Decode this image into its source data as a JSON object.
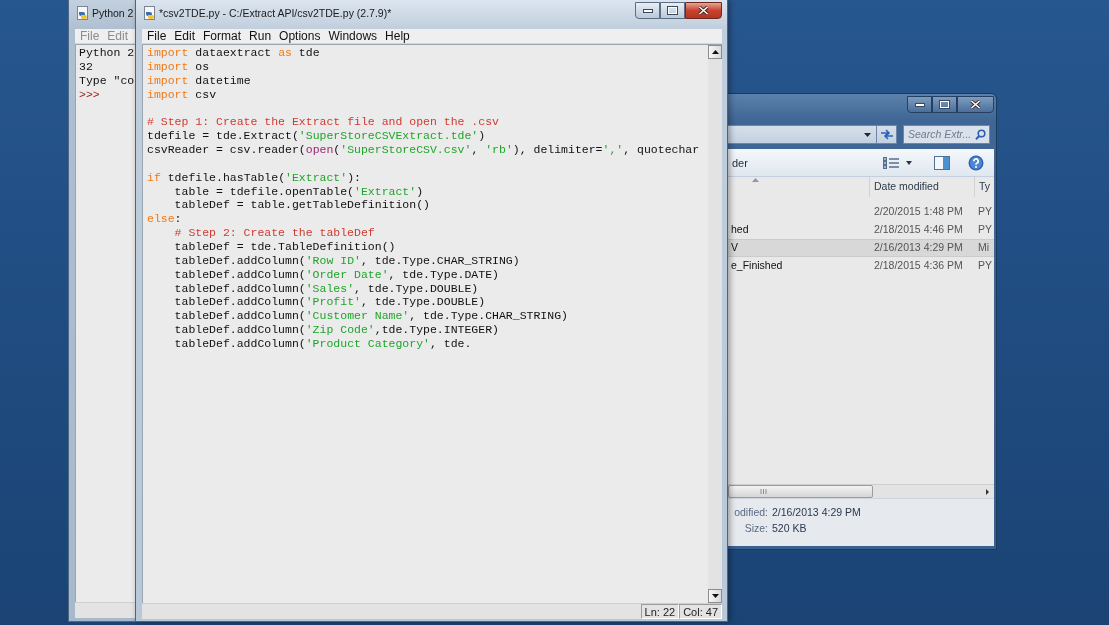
{
  "shell_window": {
    "title": "Python 2",
    "menu": [
      "File",
      "Edit"
    ],
    "lines": [
      {
        "kind": "output",
        "text": "Python 2"
      },
      {
        "kind": "output",
        "text": "32"
      },
      {
        "kind": "output",
        "text": "Type \"co"
      },
      {
        "kind": "prompt",
        "text": ">>>"
      }
    ]
  },
  "editor_window": {
    "title": "*csv2TDE.py - C:/Extract API/csv2TDE.py (2.7.9)*",
    "menu": [
      "File",
      "Edit",
      "Format",
      "Run",
      "Options",
      "Windows",
      "Help"
    ],
    "code_lines": [
      {
        "kind": "code",
        "tokens": [
          {
            "kind": "keyword",
            "text": "import"
          },
          {
            "kind": "plain",
            "text": " dataextract "
          },
          {
            "kind": "keyword",
            "text": "as"
          },
          {
            "kind": "plain",
            "text": " tde"
          }
        ]
      },
      {
        "kind": "code",
        "tokens": [
          {
            "kind": "keyword",
            "text": "import"
          },
          {
            "kind": "plain",
            "text": " os"
          }
        ]
      },
      {
        "kind": "code",
        "tokens": [
          {
            "kind": "keyword",
            "text": "import"
          },
          {
            "kind": "plain",
            "text": " datetime"
          }
        ]
      },
      {
        "kind": "code",
        "tokens": [
          {
            "kind": "keyword",
            "text": "import"
          },
          {
            "kind": "plain",
            "text": " csv"
          }
        ]
      },
      {
        "kind": "blank"
      },
      {
        "kind": "code",
        "tokens": [
          {
            "kind": "comment",
            "text": "# Step 1: Create the Extract file and open the .csv"
          }
        ]
      },
      {
        "kind": "code",
        "tokens": [
          {
            "kind": "plain",
            "text": "tdefile = tde.Extract("
          },
          {
            "kind": "string",
            "text": "'SuperStoreCSVExtract.tde'"
          },
          {
            "kind": "plain",
            "text": ")"
          }
        ]
      },
      {
        "kind": "code",
        "tokens": [
          {
            "kind": "plain",
            "text": "csvReader = csv.reader("
          },
          {
            "kind": "builtin",
            "text": "open"
          },
          {
            "kind": "plain",
            "text": "("
          },
          {
            "kind": "string",
            "text": "'SuperStoreCSV.csv'"
          },
          {
            "kind": "plain",
            "text": ", "
          },
          {
            "kind": "string",
            "text": "'rb'"
          },
          {
            "kind": "plain",
            "text": "), delimiter="
          },
          {
            "kind": "string",
            "text": "','"
          },
          {
            "kind": "plain",
            "text": ", quotechar"
          }
        ]
      },
      {
        "kind": "blank"
      },
      {
        "kind": "code",
        "tokens": [
          {
            "kind": "keyword",
            "text": "if"
          },
          {
            "kind": "plain",
            "text": " tdefile.hasTable("
          },
          {
            "kind": "string",
            "text": "'Extract'"
          },
          {
            "kind": "plain",
            "text": "):"
          }
        ],
        "children": [
          {
            "kind": "code",
            "tokens": [
              {
                "kind": "plain",
                "text": "table = tdefile.openTable("
              },
              {
                "kind": "string",
                "text": "'Extract'"
              },
              {
                "kind": "plain",
                "text": ")"
              }
            ]
          },
          {
            "kind": "code",
            "tokens": [
              {
                "kind": "plain",
                "text": "tableDef = table.getTableDefinition()"
              }
            ]
          }
        ]
      },
      {
        "kind": "code",
        "tokens": [
          {
            "kind": "keyword",
            "text": "else"
          },
          {
            "kind": "plain",
            "text": ":"
          }
        ],
        "children": [
          {
            "kind": "code",
            "tokens": [
              {
                "kind": "comment",
                "text": "# Step 2: Create the tableDef"
              }
            ]
          },
          {
            "kind": "code",
            "tokens": [
              {
                "kind": "plain",
                "text": "tableDef = tde.TableDefinition()"
              }
            ]
          },
          {
            "kind": "code",
            "tokens": [
              {
                "kind": "plain",
                "text": "tableDef.addColumn("
              },
              {
                "kind": "string",
                "text": "'Row ID'"
              },
              {
                "kind": "plain",
                "text": ", tde.Type.CHAR_STRING)"
              }
            ]
          },
          {
            "kind": "code",
            "tokens": [
              {
                "kind": "plain",
                "text": "tableDef.addColumn("
              },
              {
                "kind": "string",
                "text": "'Order Date'"
              },
              {
                "kind": "plain",
                "text": ", tde.Type.DATE)"
              }
            ]
          },
          {
            "kind": "code",
            "tokens": [
              {
                "kind": "plain",
                "text": "tableDef.addColumn("
              },
              {
                "kind": "string",
                "text": "'Sales'"
              },
              {
                "kind": "plain",
                "text": ", tde.Type.DOUBLE)"
              }
            ]
          },
          {
            "kind": "code",
            "tokens": [
              {
                "kind": "plain",
                "text": "tableDef.addColumn("
              },
              {
                "kind": "string",
                "text": "'Profit'"
              },
              {
                "kind": "plain",
                "text": ", tde.Type.DOUBLE)"
              }
            ]
          },
          {
            "kind": "code",
            "tokens": [
              {
                "kind": "plain",
                "text": "tableDef.addColumn("
              },
              {
                "kind": "string",
                "text": "'Customer Name'"
              },
              {
                "kind": "plain",
                "text": ", tde.Type.CHAR_STRING)"
              }
            ]
          },
          {
            "kind": "code",
            "tokens": [
              {
                "kind": "plain",
                "text": "tableDef.addColumn("
              },
              {
                "kind": "string",
                "text": "'Zip Code'"
              },
              {
                "kind": "plain",
                "text": ",tde.Type.INTEGER)"
              }
            ]
          },
          {
            "kind": "code",
            "tokens": [
              {
                "kind": "plain",
                "text": "tableDef.addColumn("
              },
              {
                "kind": "string",
                "text": "'Product Category'"
              },
              {
                "kind": "plain",
                "text": ", tde."
              }
            ]
          }
        ]
      }
    ],
    "status_bar": {
      "line": "Ln: 22",
      "column": "Col: 47"
    }
  },
  "explorer_window": {
    "search": {
      "placeholder": "Search Extr..."
    },
    "toolbar_label": "der",
    "columns": [
      "Date modified",
      "Ty"
    ],
    "rows": [
      {
        "date_modified": "2/20/2015 1:48 PM",
        "type": "PY",
        "selected": false
      },
      {
        "name": "hed",
        "date_modified": "2/18/2015 4:46 PM",
        "type": "PY",
        "selected": false
      },
      {
        "name": "V",
        "date_modified": "2/16/2013 4:29 PM",
        "type": "Mi",
        "selected": true
      },
      {
        "name": "e_Finished",
        "date_modified": "2/18/2015 4:36 PM",
        "type": "PY",
        "selected": false
      }
    ],
    "details": [
      {
        "label": "odified:",
        "value": "2/16/2013 4:29 PM"
      },
      {
        "label": "Size:",
        "value": "520 KB"
      }
    ]
  }
}
